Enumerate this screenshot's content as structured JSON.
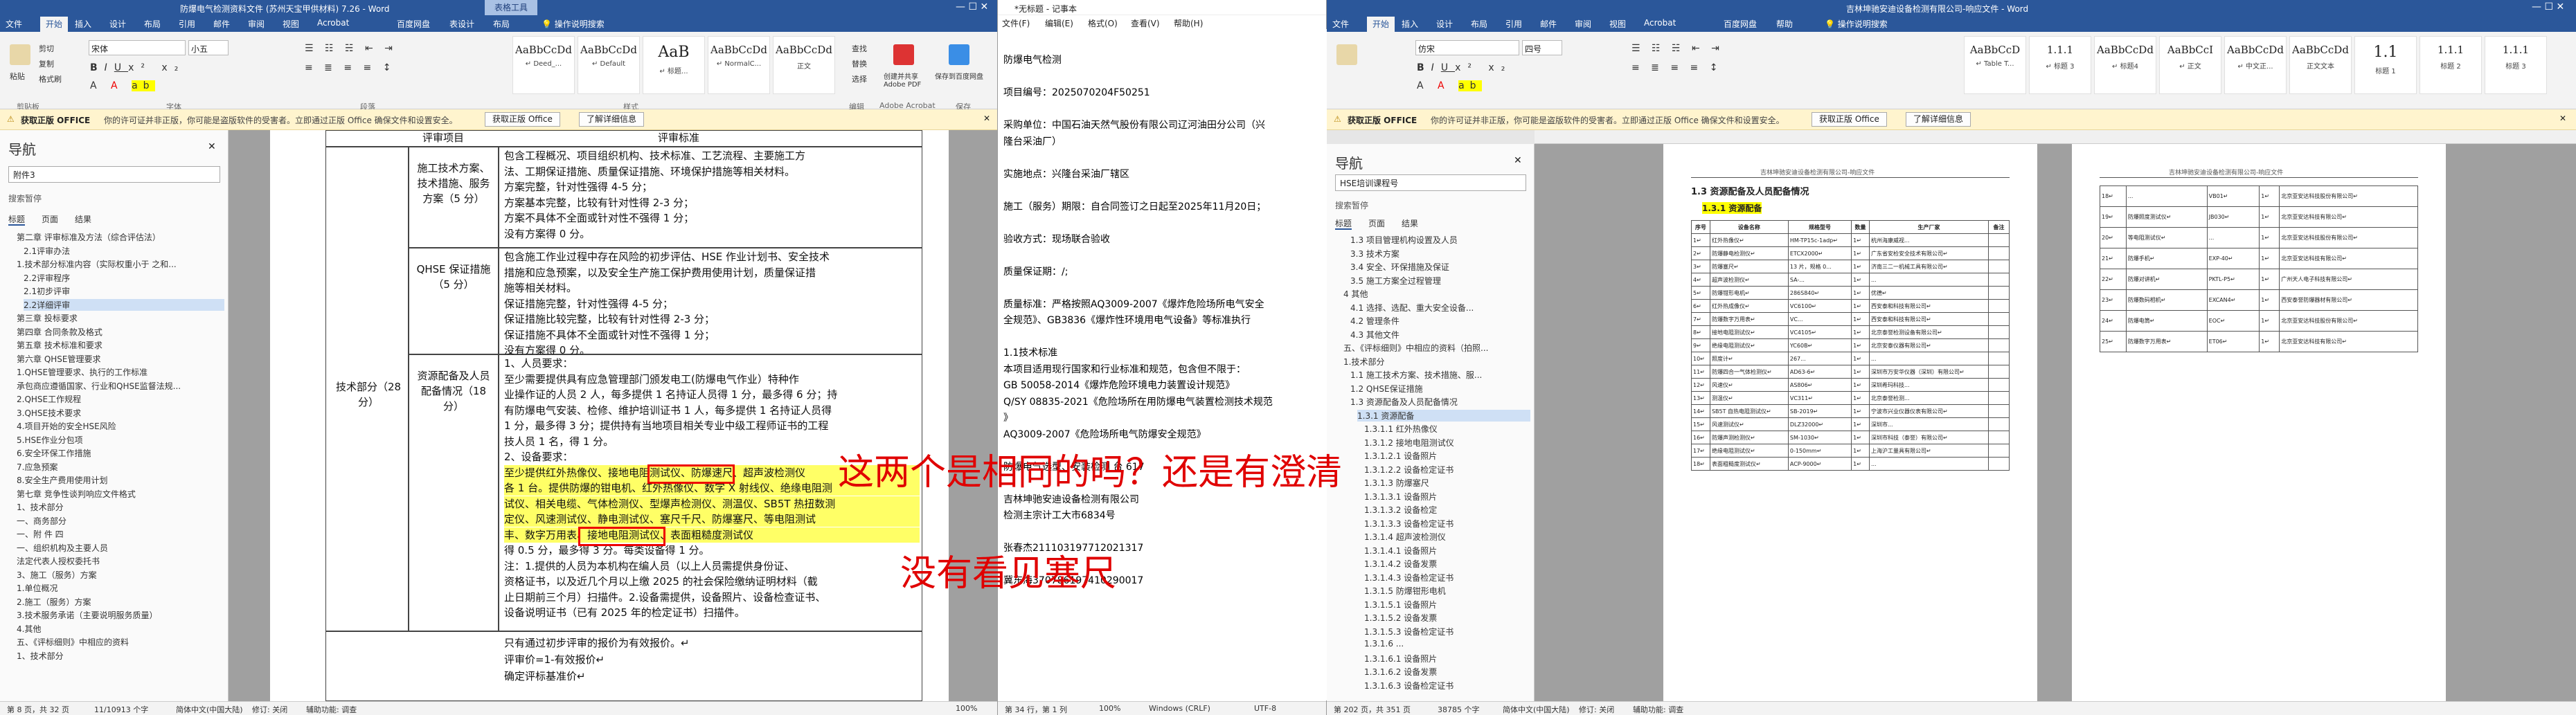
{
  "left_window": {
    "title": "防爆电气检测资料文件 (苏州天宝甲供材料) 7.26 - Word",
    "tools_title": "表格工具",
    "tabs": [
      "文件",
      "开始",
      "插入",
      "设计",
      "布局",
      "引用",
      "邮件",
      "审阅",
      "视图",
      "Acrobat",
      "百度网盘",
      "表设计",
      "布局"
    ],
    "tell_me": "操作说明搜索",
    "clipboard": {
      "paste": "粘贴",
      "cut": "剪切",
      "copy": "复制",
      "format_painter": "格式刷"
    },
    "font_name": "宋体",
    "font_size": "小五",
    "styles": [
      {
        "sample": "AaBbCcDd",
        "label": "↵ Deed_..."
      },
      {
        "sample": "AaBbCcDd",
        "label": "↵ Default"
      },
      {
        "sample": "AaB",
        "label": "↵ 标题..."
      },
      {
        "sample": "AaBbCcDd",
        "label": "↵ NormalC..."
      },
      {
        "sample": "AaBbCcDd",
        "label": "正文"
      }
    ],
    "edit_buttons": [
      "查找",
      "替换",
      "选择"
    ],
    "pdf_buttons": [
      "创建并共享 Adobe PDF"
    ],
    "baidu_buttons": [
      "保存到百度网盘"
    ],
    "groups": [
      "剪贴板",
      "字体",
      "段落",
      "样式",
      "编辑",
      "Adobe Acrobat",
      "保存"
    ],
    "message": {
      "bold": "获取正版 OFFICE",
      "text": "你的许可证并非正版，你可能是盗版软件的受害者。立即通过正版 Office 确保文件和设置安全。",
      "button1": "获取正版 Office",
      "button2": "了解详细信息"
    },
    "nav": {
      "title": "导航",
      "search_value": "附件3",
      "hint": "搜索暂停",
      "tabs": [
        "标题",
        "页面",
        "结果"
      ],
      "items": [
        "第二章 评审标准及方法（综合评估法）",
        "2.1评审办法",
        "1.技术部分标准内容（实际权重小于 之和...",
        "2.2评审程序",
        "2.1初步评审",
        "2.2详细评审",
        "第三章 投标要求",
        "第四章 合同条款及格式",
        "第五章 技术标准和要求",
        "第六章 QHSE管理要求",
        "1.QHSE管理要求、执行的工作标准",
        "承包商应遵循国家、行业和QHSE监督法规...",
        "2.QHSE工作规程",
        "3.QHSE技术要求",
        "4.项目开始的安全HSE风险",
        "5.HSE作业分包项",
        "6.安全环保工作措施",
        "7.应急预案",
        "8.安全生产费用使用计划",
        "第七章 竞争性谈判响应文件格式",
        "1、技术部分",
        "一、商务部分",
        "一、附 件 四",
        "一、组织机构及主要人员",
        "法定代表人授权委托书",
        "3、施工（服务）方案",
        "1.单位概况",
        "2.施工（服务）方案",
        "3.技术服务承诺（主要说明服务质量）",
        "4.其他",
        "五、《评标细则》中相应的资料",
        "1、技术部分"
      ],
      "selected_index": 5
    },
    "table": {
      "header_left": "评审项目",
      "header_right": "评审标准",
      "row_label_tech": "技术部分（28 分）",
      "rows": [
        {
          "label": "施工技术方案、技术措施、服务方案（5 分）",
          "lines": [
            "包含工程概况、项目组织机构、技术标准、工艺流程、主要施工方",
            "法、工期保证措施、质量保证措施、环境保护措施等相关材料。",
            "方案完整，针对性强得 4-5 分；",
            "方案基本完整，比较有针对性得 2-3 分；",
            "方案不具体不全面或针对性不强得 1 分；",
            "没有方案得 0 分。"
          ]
        },
        {
          "label": "QHSE 保证措施（5 分）",
          "lines": [
            "包含施工作业过程中存在风险的初步评估、HSE 作业计划书、安全技术",
            "措施和应急预案，以及安全生产施工保护费用使用计划，质量保证措",
            "施等相关材料。",
            "保证措施完整，针对性强得 4-5 分；",
            "保证措施比较完整，比较有针对性得 2-3 分；",
            "保证措施不具体不全面或针对性不强得 1 分；",
            "没有方案得 0 分。"
          ]
        },
        {
          "label": "资源配备及人员配备情况（18 分）",
          "lines": [
            "1、人员要求：",
            "至少需要提供具有应急管理部门颁发电工(防爆电气作业）特种作",
            "业操作证的人员 2 人，每多提供 1 名持证人员得 1 分，最多得 6 分；持",
            "有防爆电气安装、检修、维护培训证书 1 人，每多提供 1 名持证人员得",
            "1 分，最多得 3 分；提供持有当地项目相关专业中级工程师证书的工程",
            "技人员 1 名，得 1 分。",
            "2、设备要求：",
            "至少提供红外热像仪、接地电阻测试仪、防爆速尺、超声波检测仪",
            "各 1 台。提供防爆的钳电机、红外热像仪、数字 X 射线仪、绝缘电阻测",
            "试仪、相关电缆、气体检测仪、型爆声检测仪、测温仪、SB5T 热扭数测",
            "定仪、风速测试仪、静电测试仪、塞尺千尺、防爆塞尺、等电阻测试",
            "丰、数字万用表、接地电阻测试仪、表面粗糙度测试仪",
            "得 0.5 分，最多得 3 分。每类设备得 1 分。",
            "注：1.提供的人员为本机构在编人员（以上人员需提供身份证、",
            "资格证书，以及近几个月以上缴 2025 的社会保险缴纳证明材料（截",
            "止日期前三个月）扫描件。2.设备需提供，设备照片、设备检查证书、",
            "设备说明证书（已有 2025 年的检定证书）扫描件。"
          ]
        }
      ],
      "footer_lines": [
        "只有通过初步评审的报价为有效报价。↵",
        "评审价=1-有效报价↵",
        "确定评标基准价↵"
      ]
    },
    "status": [
      "第 8 页，共 32 页",
      "11/10913 个字",
      "简体中文(中国大陆)",
      "修订: 关闭",
      "辅助功能: 调查"
    ],
    "zoom": "100%"
  },
  "notepad": {
    "title": "*无标题 - 记事本",
    "menu": [
      "文件(F)",
      "编辑(E)",
      "格式(O)",
      "查看(V)",
      "帮助(H)"
    ],
    "lines": [
      "防爆电气检测",
      "",
      "项目编号：2025070204F50251",
      "",
      "采购单位：中国石油天然气股份有限公司辽河油田分公司（兴",
      "隆台采油厂）",
      "",
      "实施地点：兴隆台采油厂辖区",
      "",
      "施工（服务）期限：自合同签订之日起至2025年11月20日；",
      "",
      "验收方式：现场联合验收",
      "",
      "质量保证期：/;",
      "",
      "质量标准：严格按照AQ3009-2007《爆炸危险场所电气安全",
      "全规范》、GB3836《爆炸性环境用电气设备》等标准执行",
      "",
      "1.1技术标准",
      "本项目适用现行国家和行业标准和规范，包含但不限于：",
      "GB 50058-2014《爆炸危险环境电力装置设计规范》",
      "Q/SY 08835-2021《危险场所在用防爆电气装置检测技术规范",
      "》",
      "AQ3009-2007《危险场所电气防爆安全规范》",
      "",
      "防爆电气选型、安装检测          台          617",
      "",
      "吉林坤驰安迪设备检测有限公司",
      "检测主宗计工大市6834号",
      "",
      "张春杰211103197712021317",
      "",
      "冀东海370786197410290017"
    ],
    "status": [
      "第 34 行，第 1 列",
      "100%",
      "Windows (CRLF)",
      "UTF-8"
    ]
  },
  "overlay": {
    "question": "这两个是相同的吗？还是有澄清",
    "note": "没有看见塞尺"
  },
  "right_window": {
    "title": "吉林坤驰安迪设备检测有限公司-响应文件 - Word",
    "tabs": [
      "文件",
      "开始",
      "插入",
      "设计",
      "布局",
      "引用",
      "邮件",
      "审阅",
      "视图",
      "Acrobat",
      "百度网盘",
      "帮助"
    ],
    "tell_me": "操作说明搜索",
    "font_name": "仿宋",
    "font_size": "四号",
    "styles": [
      {
        "sample": "AaBbCcD",
        "label": "↵ Table T..."
      },
      {
        "sample": "1.1.1",
        "label": "↵ 标题 3"
      },
      {
        "sample": "AaBbCcDd",
        "label": "↵ 标题4"
      },
      {
        "sample": "AaBbCcI",
        "label": "↵ 正文"
      },
      {
        "sample": "AaBbCcDd",
        "label": "↵ 中文正..."
      },
      {
        "sample": "AaBbCcDd",
        "label": "正文文本"
      },
      {
        "sample": "1.1",
        "label": "标题 1"
      },
      {
        "sample": "1.1.1",
        "label": "标题 2"
      },
      {
        "sample": "1.1.1",
        "label": "标题 3"
      }
    ],
    "message": {
      "bold": "获取正版 OFFICE",
      "text": "你的许可证并非正版，你可能是盗版软件的受害者。立即通过正版 Office 确保文件和设置安全。",
      "button1": "获取正版 Office",
      "button2": "了解详细信息"
    },
    "nav": {
      "title": "导航",
      "search_value": "HSE培训课程号",
      "hint": "搜索暂停",
      "tabs": [
        "标题",
        "页面",
        "结果"
      ],
      "items": [
        "1.3 项目管理机构设置及人员",
        "3.3 技术方案",
        "3.4 安全、环保措施及保证",
        "3.5 施工方案全过程管理",
        "4 其他",
        "4.1 选择、选配、重大安全设备...",
        "4.2 管理条件",
        "4.3 其他文件",
        "五、《评标细则》中相应的资料（拍照...",
        "1.技术部分",
        "1.1 施工技术方案、技术措施、服...",
        "1.2 QHSE保证措施",
        "1.3 资源配备及人员配备情况",
        "1.3.1 资源配备",
        "1.3.1.1 红外热像仪",
        "1.3.1.2 接地电阻测试仪",
        "1.3.1.2.1 设备照片",
        "1.3.1.2.2 设备检定证书",
        "1.3.1.3 防爆塞尺",
        "1.3.1.3.1 设备照片",
        "1.3.1.3.2 设备检定",
        "1.3.1.3.3 设备检定证书",
        "1.3.1.4 超声波检测仪",
        "1.3.1.4.1 设备照片",
        "1.3.1.4.2 设备发票",
        "1.3.1.4.3 设备检定证书",
        "1.3.1.5 防爆钳形电机",
        "1.3.1.5.1 设备照片",
        "1.3.1.5.2 设备发票",
        "1.3.1.5.3 设备检定证书",
        "1.3.1.6 ...",
        "1.3.1.6.1 设备照片",
        "1.3.1.6.2 设备发票",
        "1.3.1.6.3 设备检定证书"
      ],
      "selected_index": 13
    },
    "page_heading_1": "1.3 资源配备及人员配备情况",
    "page_heading_2": "1.3.1 资源配备",
    "page_header_small": "吉林坤驰安迪设备检测有限公司-响应文件",
    "page1_header": [
      "序号",
      "设备名称",
      "规格型号",
      "数量",
      "生产厂家",
      "备注"
    ],
    "page1_rows": [
      [
        "1↵",
        "红外热像仪↵",
        "HM-TP15c-1adp↵",
        "1↵",
        "杭州海康威视...",
        ""
      ],
      [
        "2↵",
        "防爆静电检测仪↵",
        "ETCX2000↵",
        "1↵",
        "广东省安检安全技术有限公司↵",
        ""
      ],
      [
        "3↵",
        "防爆塞尺↵",
        "13 片，规格 0...",
        "1↵",
        "济南三二一机械工具有限公司↵",
        ""
      ],
      [
        "4↵",
        "超声波检测仪↵",
        "SA-...",
        "1↵",
        "...",
        ""
      ],
      [
        "5↵",
        "防爆钳形电机↵",
        "286S840↵",
        "1↵",
        "优德↵",
        ""
      ],
      [
        "6↵",
        "红外热成像仪↵",
        "VC6100↵",
        "1↵",
        "西安泰和科技有限公司↵",
        ""
      ],
      [
        "7↵",
        "防爆数字万用表↵",
        "VC...",
        "1↵",
        "西安泰和科技有限公司↵",
        ""
      ],
      [
        "8↵",
        "接地电阻测试仪↵",
        "VC4105↵",
        "1↵",
        "北京泰誉检测设备有限公司↵",
        ""
      ],
      [
        "9↵",
        "绝缘电阻测试仪↵",
        "YC60B↵",
        "1↵",
        "北京安泰仪器有限公司↵",
        ""
      ],
      [
        "10↵",
        "照度计↵",
        "267...",
        "1↵",
        "...",
        ""
      ],
      [
        "11↵",
        "防爆四合一气体检测仪↵",
        "AD63-6↵",
        "1↵",
        "深圳市万安华仪器（深圳）有限公司↵",
        ""
      ],
      [
        "12↵",
        "风速仪↵",
        "AS806↵",
        "1↵",
        "深圳希玛科技...",
        ""
      ],
      [
        "13↵",
        "测温仪↵",
        "VC311↵",
        "1↵",
        "北京泰誉检测...",
        ""
      ],
      [
        "14↵",
        "SB5T 自热电阻测试仪↵",
        "SB-2019↵",
        "1↵",
        "宁波市兴业仪器仪表有限公司↵",
        ""
      ],
      [
        "15↵",
        "风速测试仪↵",
        "DLZ32000↵",
        "1↵",
        "深圳市...",
        ""
      ],
      [
        "16↵",
        "防爆声测检测仪↵",
        "SM-1030↵",
        "1↵",
        "深圳市科技（泰誉）有限公司↵",
        ""
      ],
      [
        "17↵",
        "绝缘电阻测试仪↵",
        "0-150mm↵",
        "1↵",
        "上海沪工量具有限公司↵",
        ""
      ],
      [
        "18↵",
        "表面粗糙度测试仪↵",
        "ACP-9000↵",
        "1↵",
        "...",
        ""
      ]
    ],
    "page2_rows": [
      [
        "18↵",
        "...",
        "VB01↵",
        "1↵",
        "北京亚安达科技股份有限公司↵"
      ],
      [
        "19↵",
        "防爆照度测试仪↵",
        "JB030↵",
        "1↵",
        "北京亚安达科技有限公司↵"
      ],
      [
        "20↵",
        "等电阻测试仪↵",
        "...",
        "1↵",
        "北京亚安达科技股份有限公司↵"
      ],
      [
        "21↵",
        "防爆手机↵",
        "EXP-40↵",
        "1↵",
        "北京亚安达科技有限公司↵"
      ],
      [
        "22↵",
        "防爆对讲机↵",
        "PKTL-P5↵",
        "1↵",
        "广州天人电子科技有限公司↵"
      ],
      [
        "23↵",
        "防爆数码相机↵",
        "EXCAN4↵",
        "1↵",
        "西安泰誉防爆器材有限公司↵"
      ],
      [
        "24↵",
        "防爆电筒↵",
        "EOC↵",
        "1↵",
        "北京亚安达科技股份有限公司↵"
      ],
      [
        "25↵",
        "防爆数字万用表↵",
        "ET06↵",
        "1↵",
        "北京亚安达科技有限公司↵"
      ]
    ],
    "status": [
      "第 202 页，共 351 页",
      "38785 个字",
      "简体中文(中国大陆)",
      "修订: 关闭",
      "辅助功能: 调查"
    ]
  }
}
